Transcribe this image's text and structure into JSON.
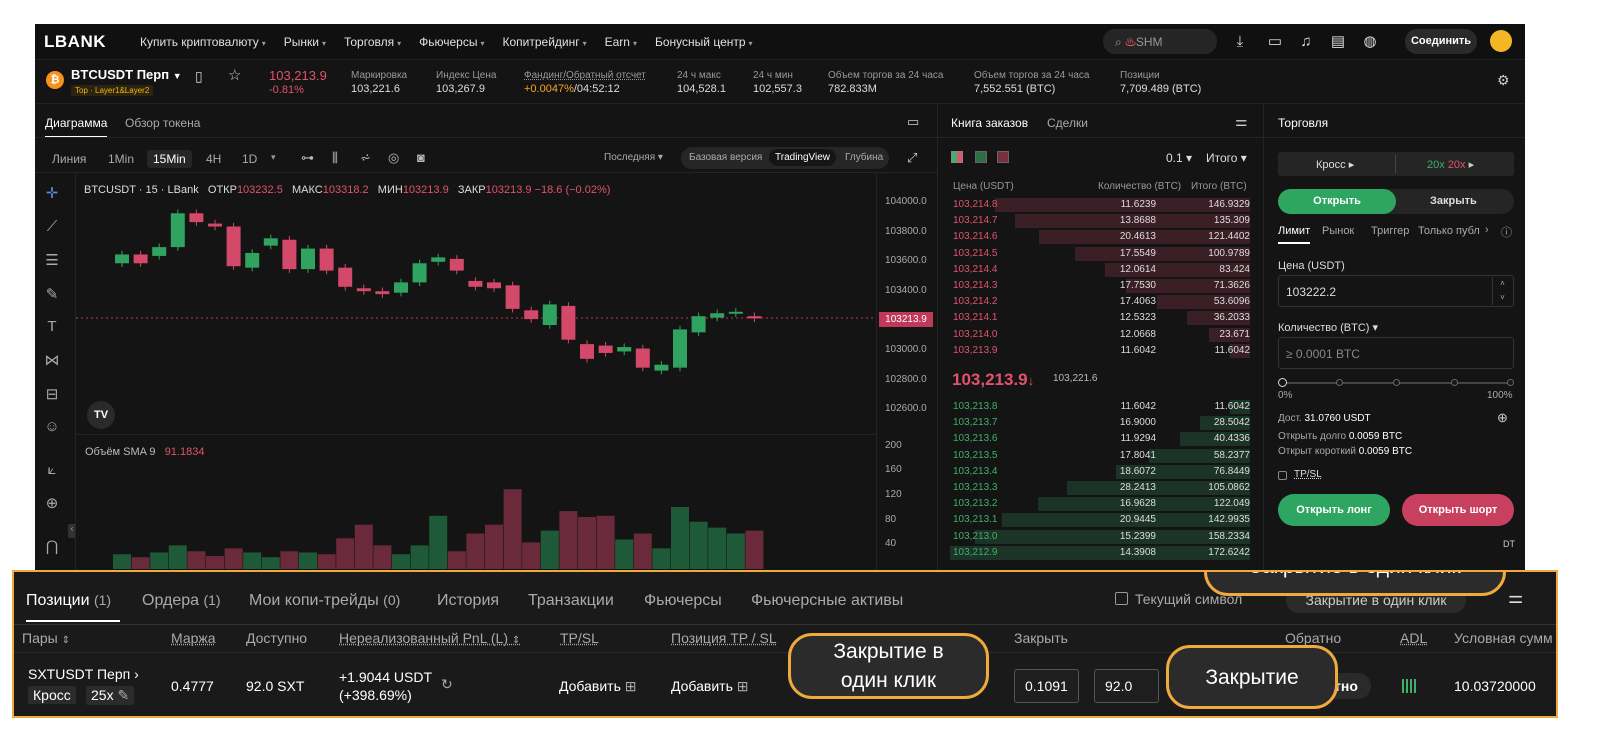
{
  "topnav": {
    "logo": "LBANK",
    "items": [
      "Купить криптовалюту",
      "Рынки",
      "Торговля",
      "Фьючерсы",
      "Копитрейдинг",
      "Earn",
      "Бонусный центр"
    ],
    "search_text": "SHM",
    "connect_label": "Соединить"
  },
  "ticker": {
    "symbol": "BTCUSDT Перп",
    "tag": "Top · Layer1&Layer2",
    "price": "103,213.9",
    "change": "-0.81%",
    "stats": [
      {
        "label": "Маркировка",
        "value": "103,221.6"
      },
      {
        "label": "Индекс Цена",
        "value": "103,267.9"
      },
      {
        "label": "Фандинг/Обратный отсчет",
        "value": "+0.0047%",
        "value2": "/04:52:12"
      },
      {
        "label": "24 ч макс",
        "value": "104,528.1"
      },
      {
        "label": "24 ч мин",
        "value": "102,557.3"
      },
      {
        "label": "Объем торгов за 24 часа",
        "value": "782.833M"
      },
      {
        "label": "Объем торгов за 24 часа",
        "value": "7,552.551 (BTC)"
      },
      {
        "label": "Позиции",
        "value": "7,709.489 (BTC)"
      }
    ]
  },
  "chart_panel": {
    "tabs": [
      "Диаграмма",
      "Обзор токена"
    ],
    "timeframes": [
      "Линия",
      "1Min",
      "15Min",
      "4H",
      "1D"
    ],
    "price_type": "Последняя",
    "views": [
      "Базовая версия",
      "TradingView",
      "Глубина"
    ],
    "title": "BTCUSDT · 15 · LBank",
    "ohlc": {
      "o_label": "ОТКР",
      "o": "103232.5",
      "h_label": "МАКС",
      "h": "103318.2",
      "l_label": "МИН",
      "l": "103213.9",
      "c_label": "ЗАКР",
      "c": "103213.9",
      "chg": "−18.6 (−0.02%)"
    },
    "y_ticks": [
      "104000.0",
      "103800.0",
      "103600.0",
      "103400.0",
      "103200.0",
      "103000.0",
      "102800.0",
      "102600.0"
    ],
    "last_price_tag": "103213.9",
    "volume_label": "Объём SMA 9",
    "volume_value": "91.1834",
    "vol_ticks": [
      "200",
      "160",
      "120",
      "80",
      "40"
    ],
    "tv_logo": "TV"
  },
  "chart_data": {
    "type": "candlestick",
    "title": "BTCUSDT · 15 · LBank",
    "candles": [
      {
        "o": 103590,
        "c": 103650
      },
      {
        "o": 103650,
        "c": 103590
      },
      {
        "o": 103640,
        "c": 103700
      },
      {
        "o": 103700,
        "c": 103930
      },
      {
        "o": 103930,
        "c": 103870
      },
      {
        "o": 103860,
        "c": 103840
      },
      {
        "o": 103840,
        "c": 103570
      },
      {
        "o": 103560,
        "c": 103660
      },
      {
        "o": 103710,
        "c": 103760
      },
      {
        "o": 103750,
        "c": 103550
      },
      {
        "o": 103550,
        "c": 103690
      },
      {
        "o": 103690,
        "c": 103540
      },
      {
        "o": 103560,
        "c": 103430
      },
      {
        "o": 103420,
        "c": 103400
      },
      {
        "o": 103400,
        "c": 103380
      },
      {
        "o": 103390,
        "c": 103460
      },
      {
        "o": 103460,
        "c": 103590
      },
      {
        "o": 103600,
        "c": 103630
      },
      {
        "o": 103620,
        "c": 103540
      },
      {
        "o": 103470,
        "c": 103430
      },
      {
        "o": 103460,
        "c": 103420
      },
      {
        "o": 103440,
        "c": 103280
      },
      {
        "o": 103270,
        "c": 103210
      },
      {
        "o": 103170,
        "c": 103310
      },
      {
        "o": 103300,
        "c": 103070
      },
      {
        "o": 103040,
        "c": 102940
      },
      {
        "o": 103030,
        "c": 102980
      },
      {
        "o": 102990,
        "c": 103020
      },
      {
        "o": 103010,
        "c": 102880
      },
      {
        "o": 102860,
        "c": 102900
      },
      {
        "o": 102880,
        "c": 103140
      },
      {
        "o": 103120,
        "c": 103230
      },
      {
        "o": 103220,
        "c": 103250
      },
      {
        "o": 103250,
        "c": 103260
      },
      {
        "o": 103230,
        "c": 103215
      }
    ],
    "volumes": [
      25,
      20,
      28,
      40,
      30,
      22,
      35,
      28,
      20,
      30,
      28,
      25,
      52,
      75,
      40,
      25,
      40,
      90,
      30,
      60,
      75,
      135,
      45,
      65,
      98,
      88,
      90,
      50,
      60,
      35,
      105,
      80,
      70,
      60,
      65
    ],
    "ylim": [
      102500,
      104100
    ],
    "vol_ylim": [
      0,
      220
    ]
  },
  "orderbook": {
    "tabs": [
      "Книга заказов",
      "Сделки"
    ],
    "precision": "0.1",
    "mode": "Итого",
    "headers": [
      "Цена (USDT)",
      "Количество (BTC)",
      "Итого (BTC)"
    ],
    "asks": [
      [
        "103,214.8",
        "11.6239",
        "146.9329"
      ],
      [
        "103,214.7",
        "13.8688",
        "135.309"
      ],
      [
        "103,214.6",
        "20.4613",
        "121.4402"
      ],
      [
        "103,214.5",
        "17.5549",
        "100.9789"
      ],
      [
        "103,214.4",
        "12.0614",
        "83.424"
      ],
      [
        "103,214.3",
        "17.7530",
        "71.3626"
      ],
      [
        "103,214.2",
        "17.4063",
        "53.6096"
      ],
      [
        "103,214.1",
        "12.5323",
        "36.2033"
      ],
      [
        "103,214.0",
        "12.0668",
        "23.671"
      ],
      [
        "103,213.9",
        "11.6042",
        "11.6042"
      ]
    ],
    "last_price": "103,213.9",
    "mark_price": "103,221.6",
    "bids": [
      [
        "103,213.8",
        "11.6042",
        "11.6042"
      ],
      [
        "103,213.7",
        "16.9000",
        "28.5042"
      ],
      [
        "103,213.6",
        "11.9294",
        "40.4336"
      ],
      [
        "103,213.5",
        "17.8041",
        "58.2377"
      ],
      [
        "103,213.4",
        "18.6072",
        "76.8449"
      ],
      [
        "103,213.3",
        "28.2413",
        "105.0862"
      ],
      [
        "103,213.2",
        "16.9628",
        "122.049"
      ],
      [
        "103,213.1",
        "20.9445",
        "142.9935"
      ],
      [
        "103,213.0",
        "15.2399",
        "158.2334"
      ],
      [
        "103,212.9",
        "14.3908",
        "172.6242"
      ]
    ]
  },
  "trade": {
    "title": "Торговля",
    "margin_mode": "Кросс",
    "leverage_long": "20x",
    "leverage_short": "20x",
    "open_label": "Открыть",
    "close_label": "Закрыть",
    "order_types": [
      "Лимит",
      "Рынок",
      "Триггер",
      "Только публ"
    ],
    "price_label": "Цена (USDT)",
    "price_value": "103222.2",
    "qty_label": "Количество (BTC)",
    "qty_placeholder": "≥ 0.0001 BTC",
    "slider_min": "0%",
    "slider_max": "100%",
    "available_label": "Дост.",
    "available_value": "31.0760 USDT",
    "open_long_label": "Открыть долго",
    "open_long_value": "0.0059 BTC",
    "open_short_label": "Открыт короткий",
    "open_short_value": "0.0059 BTC",
    "tpsl_label": "TP/SL",
    "btn_long": "Открыть лонг",
    "btn_short": "Открыть шорт",
    "cut_text": "DT"
  },
  "positions_panel": {
    "tabs": [
      "Позиции",
      "Ордера",
      "Мои копи-трейды",
      "История",
      "Транзакции",
      "Фьючерсы",
      "Фьючерсные активы"
    ],
    "tab_counts": [
      "(1)",
      "(1)",
      "(0)"
    ],
    "current_symbol_label": "Текущий символ",
    "one_click_button": "Закрытие в один клик",
    "headers": [
      "Пары",
      "Маржа",
      "Доступно",
      "Нереализованный PnL (L)",
      "TP/SL",
      "Позиция TP / SL",
      "Закрыть",
      "Обратно",
      "ADL",
      "Условная сумм"
    ],
    "row": {
      "pair": "SXTUSDT Перп",
      "margin_mode": "Кросс",
      "leverage": "25x",
      "margin": "0.4777",
      "available": "92.0 SXT",
      "pnl": "+1.9044 USDT",
      "pnl_pct": "(+398.69%)",
      "tpsl_add": "Добавить",
      "pos_tpsl_add": "Добавить",
      "close_price": "0.1091",
      "close_qty": "92.0",
      "reverse_label": "Обратно",
      "notional": "10.03720000"
    }
  },
  "callouts": {
    "one_click_top": "Закрытие в один клик",
    "one_click_row_1": "Закрытие в",
    "one_click_row_2": "один клик",
    "close": "Закрытие"
  }
}
